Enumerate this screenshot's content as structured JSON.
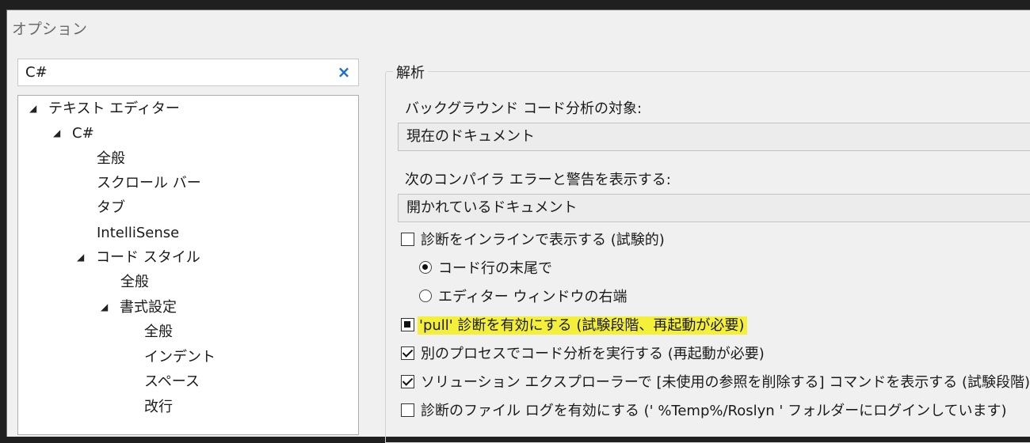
{
  "window": {
    "title": "オプション"
  },
  "search": {
    "value": "C#",
    "clear_icon": "×"
  },
  "tree": {
    "items": [
      {
        "label": "テキスト エディター",
        "expanded": true
      },
      {
        "label": "C#",
        "expanded": true
      },
      {
        "label": "全般"
      },
      {
        "label": "スクロール バー"
      },
      {
        "label": "タブ"
      },
      {
        "label": "IntelliSense"
      },
      {
        "label": "コード スタイル",
        "expanded": true
      },
      {
        "label": "全般"
      },
      {
        "label": "書式設定",
        "expanded": true
      },
      {
        "label": "全般"
      },
      {
        "label": "インデント"
      },
      {
        "label": "スペース"
      },
      {
        "label": "改行"
      }
    ]
  },
  "analysis": {
    "group_label": "解析",
    "background_label": "バックグラウンド コード分析の対象:",
    "background_value": "現在のドキュメント",
    "compiler_label": "次のコンパイラ エラーと警告を表示する:",
    "compiler_value": "開かれているドキュメント",
    "inline_diag": {
      "label": "診断をインラインで表示する (試験的)",
      "checked": false
    },
    "radio_end_of_line": {
      "label": "コード行の末尾で",
      "selected": true
    },
    "radio_right_edge": {
      "label": "エディター ウィンドウの右端",
      "selected": false
    },
    "pull_diag": {
      "label": "'pull' 診断を有効にする (試験段階、再起動が必要)",
      "state": "indeterminate",
      "highlight_color": "#f4f03a"
    },
    "separate_process": {
      "label": "別のプロセスでコード分析を実行する (再起動が必要)",
      "checked": true
    },
    "remove_unused": {
      "label": "ソリューション エクスプローラーで [未使用の参照を削除する] コマンドを表示する (試験段階)",
      "checked": true
    },
    "file_log": {
      "label": "診断のファイル ログを有効にする (' %Temp%/Roslyn ' フォルダーにログインしています)",
      "checked": false
    }
  }
}
